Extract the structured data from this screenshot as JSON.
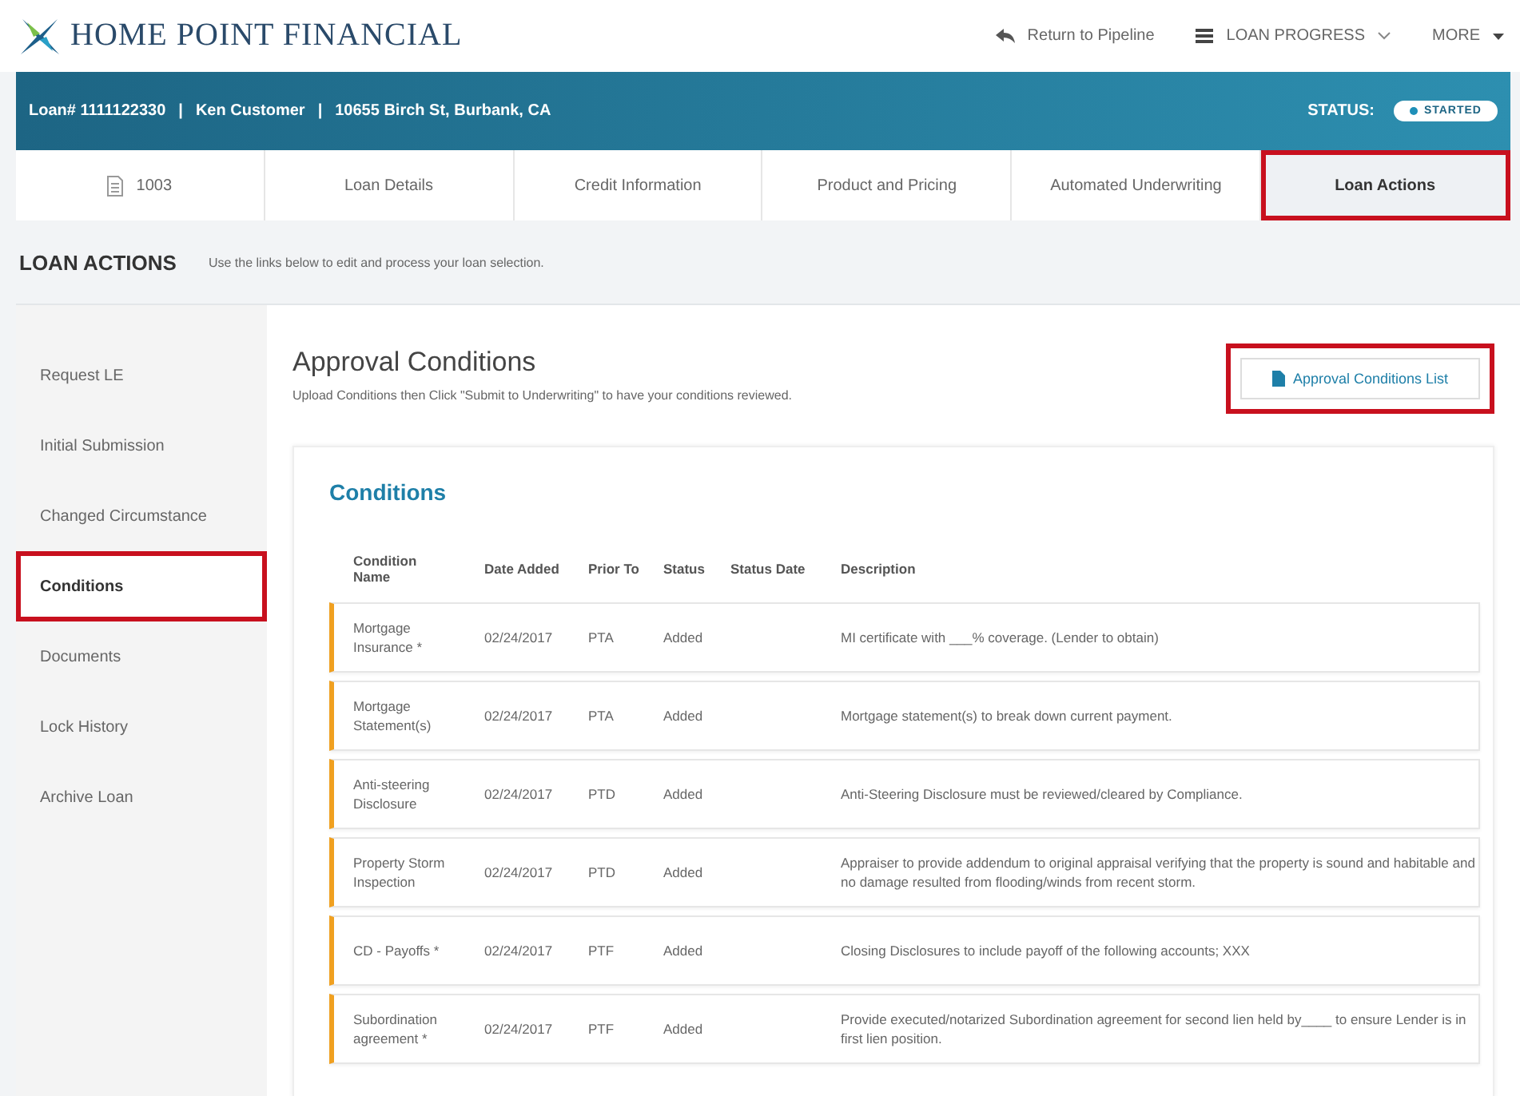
{
  "brand": {
    "name": "HOME POINT FINANCIAL"
  },
  "top_nav": [
    {
      "kind": "return",
      "label": "Return to Pipeline"
    },
    {
      "kind": "progress",
      "label": "LOAN PROGRESS"
    },
    {
      "kind": "more",
      "label": "MORE"
    }
  ],
  "loan_bar": {
    "separator": "|",
    "loan": "Loan# 1111122330",
    "customer": "Ken Customer",
    "address": "10655 Birch St, Burbank, CA",
    "status_label": "STATUS:",
    "status": "STARTED"
  },
  "tabs": [
    {
      "label": "1003",
      "icon": true,
      "selected": false,
      "highlighted": false
    },
    {
      "label": "Loan Details",
      "selected": false,
      "highlighted": false
    },
    {
      "label": "Credit Information",
      "selected": false,
      "highlighted": false
    },
    {
      "label": "Product and Pricing",
      "selected": false,
      "highlighted": false
    },
    {
      "label": "Automated Underwriting",
      "selected": false,
      "highlighted": false
    },
    {
      "label": "Loan Actions",
      "selected": true,
      "highlighted": true
    }
  ],
  "section": {
    "title": "LOAN ACTIONS",
    "hint": "Use the links below to edit and process your loan selection."
  },
  "sidebar": {
    "items": [
      {
        "label": "Request LE",
        "selected": false,
        "highlighted": false
      },
      {
        "label": "Initial Submission",
        "selected": false,
        "highlighted": false
      },
      {
        "label": "Changed Circumstance",
        "selected": false,
        "highlighted": false
      },
      {
        "label": "Conditions",
        "selected": true,
        "highlighted": true
      },
      {
        "label": "Documents",
        "selected": false,
        "highlighted": false
      },
      {
        "label": "Lock History",
        "selected": false,
        "highlighted": false
      },
      {
        "label": "Archive Loan",
        "selected": false,
        "highlighted": false
      }
    ]
  },
  "main": {
    "title": "Approval Conditions",
    "subtitle": "Upload Conditions then Click \"Submit to Underwriting\" to have your conditions reviewed.",
    "list_button": {
      "label": "Approval Conditions List",
      "highlighted": true
    }
  },
  "conditions": {
    "title": "Conditions",
    "columns": [
      "Condition Name",
      "Date Added",
      "Prior To",
      "Status",
      "Status Date",
      "Description"
    ],
    "rows": [
      {
        "name": "Mortgage Insurance *",
        "date_added": "02/24/2017",
        "prior_to": "PTA",
        "status": "Added",
        "description": "MI certificate with ___% coverage. (Lender to obtain)"
      },
      {
        "name": "Mortgage Statement(s)",
        "date_added": "02/24/2017",
        "prior_to": "PTA",
        "status": "Added",
        "description": "Mortgage statement(s) to break down current payment."
      },
      {
        "name": "Anti-steering Disclosure",
        "date_added": "02/24/2017",
        "prior_to": "PTD",
        "status": "Added",
        "description": "Anti-Steering Disclosure must be reviewed/cleared by Compliance."
      },
      {
        "name": "Property Storm Inspection",
        "date_added": "02/24/2017",
        "prior_to": "PTD",
        "status": "Added",
        "description": "Appraiser to provide addendum to original appraisal verifying that the property is sound and habitable and no damage resulted from flooding/winds from recent storm."
      },
      {
        "name": "CD - Payoffs *",
        "date_added": "02/24/2017",
        "prior_to": "PTF",
        "status": "Added",
        "description": "Closing Disclosures to include payoff of the following accounts; XXX"
      },
      {
        "name": "Subordination agreement *",
        "date_added": "02/24/2017",
        "prior_to": "PTF",
        "status": "Added",
        "description": "Provide executed/notarized Subordination agreement for second lien held by____ to ensure Lender is in first lien position."
      }
    ]
  }
}
